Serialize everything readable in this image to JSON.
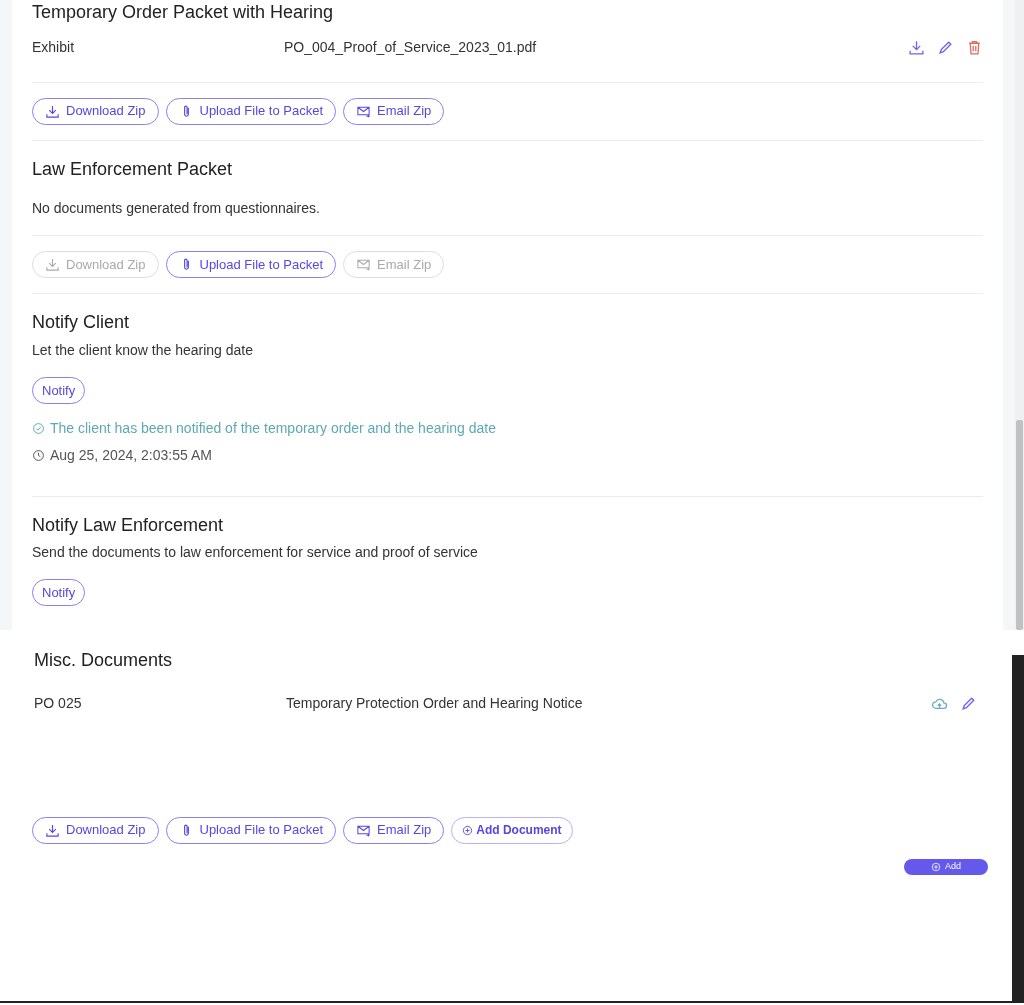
{
  "packets": [
    {
      "title": "Temporary Order Packet with Hearing",
      "documents": [
        {
          "type": "Exhibit",
          "file": "PO_004_Proof_of_Service_2023_01.pdf",
          "actions": [
            {
              "kind": "download"
            },
            {
              "kind": "edit"
            },
            {
              "kind": "delete"
            }
          ]
        }
      ],
      "buttons": [
        {
          "kind": "download",
          "label": "Download Zip",
          "disabled": false
        },
        {
          "kind": "upload",
          "label": "Upload File to Packet",
          "disabled": false
        },
        {
          "kind": "email",
          "label": "Email Zip",
          "disabled": false
        }
      ]
    },
    {
      "title": "Law Enforcement Packet",
      "empty_message": "No documents generated from questionnaires.",
      "buttons": [
        {
          "kind": "download",
          "label": "Download Zip",
          "disabled": true
        },
        {
          "kind": "upload",
          "label": "Upload File to Packet",
          "disabled": false
        },
        {
          "kind": "email",
          "label": "Email Zip",
          "disabled": true
        }
      ]
    }
  ],
  "notifications": [
    {
      "title": "Notify Client",
      "description": "Let the client know the hearing date",
      "button": "Notify",
      "status": {
        "message": "The client has been notified of the temporary order and the hearing date",
        "timestamp": "Aug 25, 2024, 2:03:55 AM"
      }
    },
    {
      "title": "Notify Law Enforcement",
      "description": "Send the documents to law enforcement for service and proof of service",
      "button": "Notify"
    }
  ],
  "misc": {
    "title": "Misc. Documents",
    "documents": [
      {
        "type": "PO 025",
        "file": "Temporary Protection Order and Hearing Notice",
        "actions": [
          {
            "kind": "upload"
          },
          {
            "kind": "edit"
          }
        ]
      }
    ],
    "buttons": [
      {
        "kind": "download",
        "label": "Download Zip",
        "disabled": false
      },
      {
        "kind": "upload",
        "label": "Upload File to Packet",
        "disabled": false
      },
      {
        "kind": "email",
        "label": "Email Zip",
        "disabled": false
      },
      {
        "kind": "add",
        "label": "Add Document",
        "disabled": false
      }
    ],
    "add_button": "Add"
  }
}
